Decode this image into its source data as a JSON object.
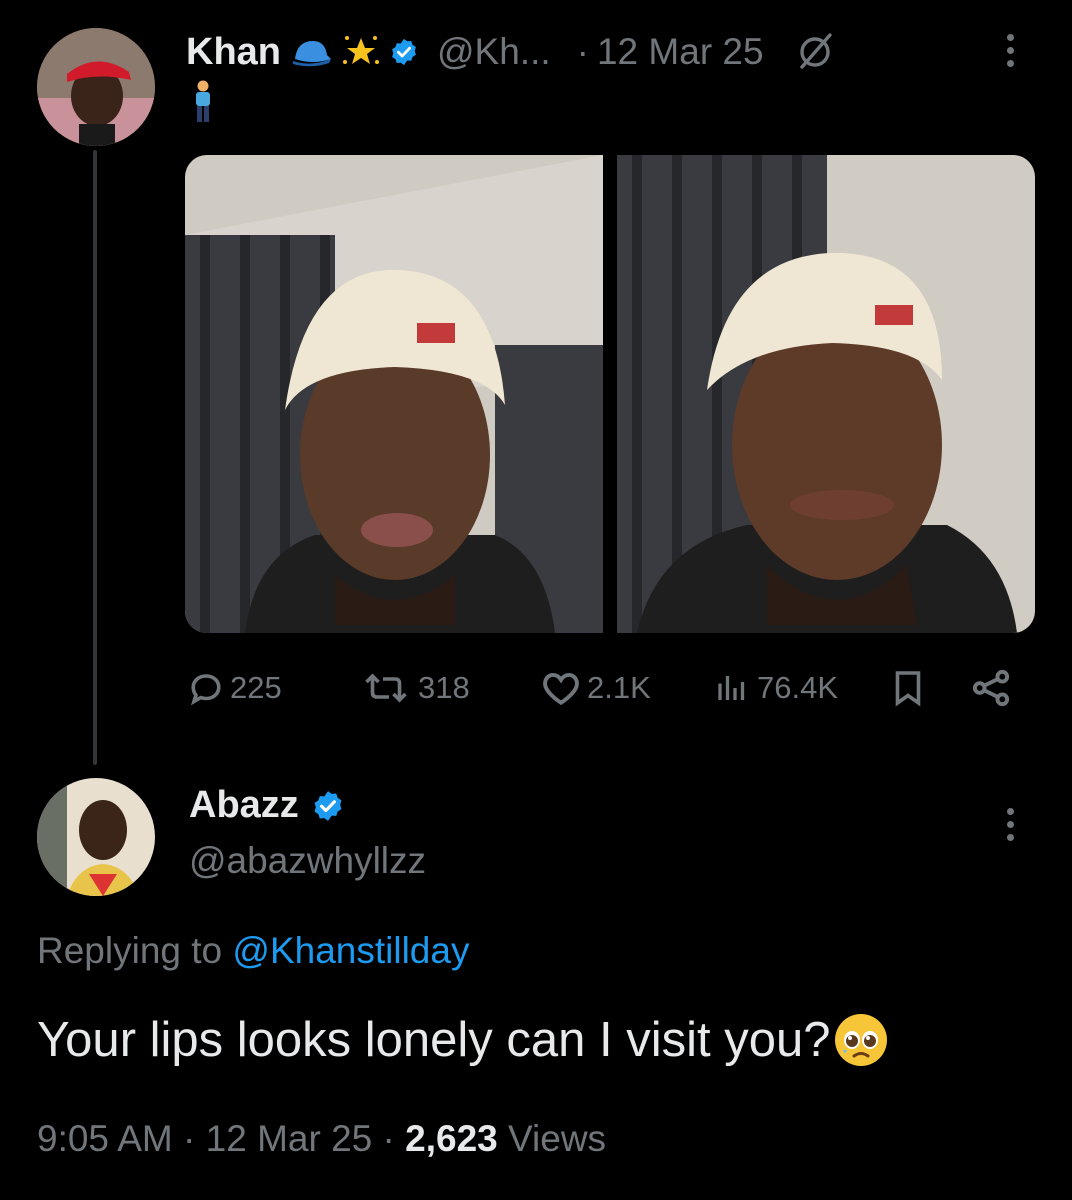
{
  "theme": {
    "background": "#000000",
    "accent": "#1d9bf0",
    "text": "#e7e9ea",
    "muted": "#71767b",
    "verified": "#1d9bf0"
  },
  "tweet": {
    "author": {
      "display_name": "Khan",
      "name_badges": [
        "blue-cap-emoji",
        "glowing-star-emoji",
        "verified-badge"
      ],
      "handle": "@Kh...",
      "avatar": "avatar-khan-red-cap"
    },
    "separator": "·",
    "date": "12 Mar 25",
    "grok_icon": "grok-icon",
    "more_icon": "more-vertical-icon",
    "body_emoji": "person-standing-emoji",
    "media": [
      {
        "alt": "selfie-white-cap-lips-pursed"
      },
      {
        "alt": "selfie-white-cap-lip-bite"
      }
    ],
    "stats": {
      "replies": {
        "icon": "reply-icon",
        "value": "225"
      },
      "retweets": {
        "icon": "retweet-icon",
        "value": "318"
      },
      "likes": {
        "icon": "heart-icon",
        "value": "2.1K"
      },
      "views": {
        "icon": "views-icon",
        "value": "76.4K"
      },
      "bookmark_icon": "bookmark-icon",
      "share_icon": "share-icon"
    }
  },
  "reply": {
    "author": {
      "display_name": "Abazz",
      "handle": "@abazwhyllzz",
      "avatar": "avatar-abazz"
    },
    "more_icon": "more-vertical-icon",
    "replying_prefix": "Replying to",
    "replying_to": "@Khanstillday",
    "text": "Your lips looks lonely can I visit you?",
    "text_emoji": "pleading-face-emoji",
    "time": "9:05 AM",
    "separator": "·",
    "date": "12 Mar 25",
    "views_count": "2,623",
    "views_label": "Views"
  }
}
